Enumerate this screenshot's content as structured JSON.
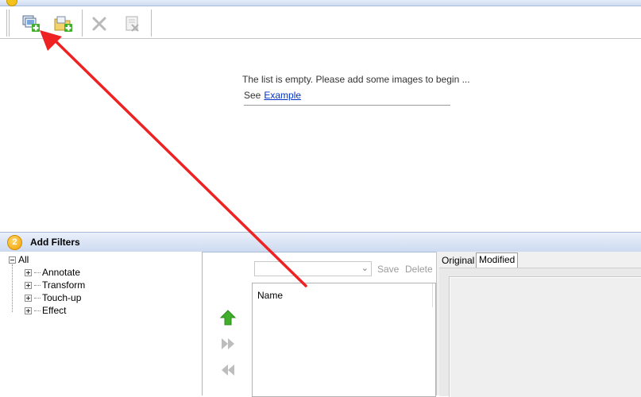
{
  "toolbar": {
    "buttons": [
      {
        "name": "add-images-button",
        "icon": "add-images-icon"
      },
      {
        "name": "add-folder-button",
        "icon": "add-folder-icon"
      },
      {
        "name": "remove-button",
        "icon": "delete-x-icon"
      },
      {
        "name": "clear-button",
        "icon": "clear-list-icon"
      }
    ]
  },
  "image_list": {
    "empty_message": "The list is empty. Please add some images to begin ...",
    "see_label": "See",
    "example_link": "Example"
  },
  "filters_panel": {
    "step_badge": "2",
    "title": "Add Filters",
    "tree": {
      "root": "All",
      "children": [
        "Annotate",
        "Transform",
        "Touch-up",
        "Effect"
      ]
    },
    "combo_value": "",
    "save_label": "Save",
    "delete_label": "Delete",
    "list_column": "Name"
  },
  "preview": {
    "tabs": [
      "Original",
      "Modified"
    ],
    "active_tab": "Modified"
  },
  "colors": {
    "header_gradient_top": "#eaf0fb",
    "header_gradient_bottom": "#cddaf0",
    "arrow_green": "#3fae2a",
    "annotation_red": "#ee2222",
    "link_blue": "#0033cc"
  }
}
